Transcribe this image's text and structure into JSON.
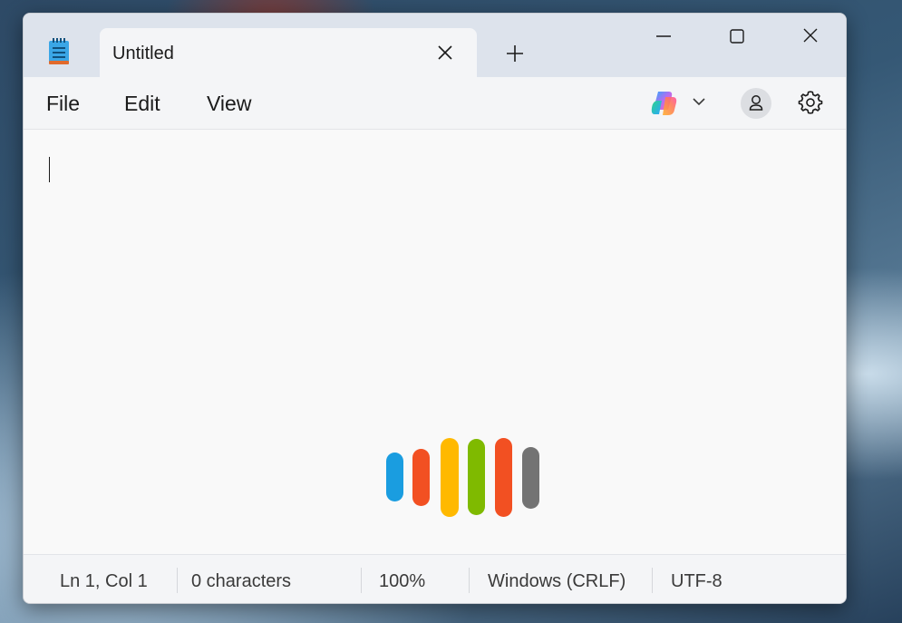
{
  "tab": {
    "title": "Untitled"
  },
  "menu": {
    "file": "File",
    "edit": "Edit",
    "view": "View"
  },
  "status": {
    "position": "Ln 1, Col 1",
    "characters": "0 characters",
    "zoom": "100%",
    "line_ending": "Windows (CRLF)",
    "encoding": "UTF-8"
  },
  "colors": {
    "titlebar": "#dde3ec",
    "tab": "#f4f5f7",
    "editor": "#f9f9f9",
    "loader": [
      "#1a9de0",
      "#f25022",
      "#ffb900",
      "#7fba00",
      "#f25022",
      "#737373"
    ]
  },
  "icons": [
    "notepad-app-icon",
    "close-icon",
    "plus-icon",
    "minimize-icon",
    "maximize-icon",
    "copilot-icon",
    "chevron-down-icon",
    "account-icon",
    "gear-icon"
  ]
}
